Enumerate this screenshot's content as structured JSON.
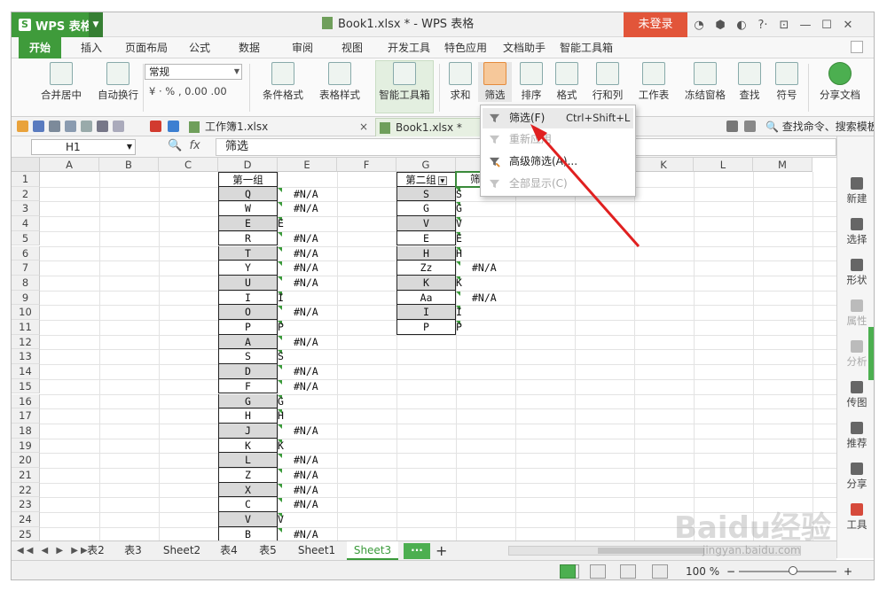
{
  "titlebar": {
    "app_name": "WPS 表格",
    "doc_title": "Book1.xlsx * - WPS 表格",
    "login": "未登录",
    "icons": [
      "skin-icon",
      "settings-icon",
      "help-icon",
      "minimize-icon",
      "maximize-icon",
      "close-icon"
    ]
  },
  "menu": {
    "tabs": [
      "开始",
      "插入",
      "页面布局",
      "公式",
      "数据",
      "审阅",
      "视图",
      "开发工具",
      "特色应用",
      "文档助手",
      "智能工具箱"
    ]
  },
  "ribbon": {
    "merge": "合并居中",
    "wrap": "自动换行",
    "format_select": "常规",
    "num_tools": "¥ · % ‚ 0.00 .00",
    "cond_format": "条件格式",
    "table_style": "表格样式",
    "smart_toolbox": "智能工具箱",
    "sum": "求和",
    "filter": "筛选",
    "sort": "排序",
    "format": "格式",
    "rowcol": "行和列",
    "worksheet": "工作表",
    "freeze": "冻结窗格",
    "find": "查找",
    "symbol": "符号",
    "share": "分享文档"
  },
  "doc_tabs": [
    {
      "label": "工作簿1.xlsx",
      "close": "×"
    },
    {
      "label": "Book1.xlsx *",
      "close": "×"
    }
  ],
  "search_cmd": "查找命令、搜索模板",
  "formula_bar": {
    "cell_ref": "H1",
    "fx": "fx",
    "content": "筛选"
  },
  "columns": [
    "A",
    "B",
    "C",
    "D",
    "E",
    "F",
    "G",
    "H",
    "I",
    "J",
    "K",
    "L",
    "M"
  ],
  "rows": [
    "1",
    "2",
    "3",
    "4",
    "5",
    "6",
    "7",
    "8",
    "9",
    "10",
    "11",
    "12",
    "13",
    "14",
    "15",
    "16",
    "17",
    "18",
    "19",
    "20",
    "21",
    "22",
    "23",
    "24",
    "25"
  ],
  "col_d": {
    "header": "第一组",
    "values": [
      "Q",
      "W",
      "E",
      "R",
      "T",
      "Y",
      "U",
      "I",
      "O",
      "P",
      "A",
      "S",
      "D",
      "F",
      "G",
      "H",
      "J",
      "K",
      "L",
      "Z",
      "X",
      "C",
      "V",
      "B"
    ]
  },
  "col_e": [
    "#N/A",
    "#N/A",
    "E",
    "#N/A",
    "#N/A",
    "#N/A",
    "#N/A",
    "I",
    "#N/A",
    "P",
    "#N/A",
    "S",
    "#N/A",
    "#N/A",
    "G",
    "H",
    "#N/A",
    "K",
    "#N/A",
    "#N/A",
    "#N/A",
    "#N/A",
    "V",
    "#N/A"
  ],
  "col_g": {
    "header": "第二组",
    "values": [
      "S",
      "G",
      "V",
      "E",
      "H",
      "Zz",
      "K",
      "Aa",
      "I",
      "P"
    ]
  },
  "col_h": {
    "header": "筛选",
    "values": [
      "S",
      "G",
      "V",
      "E",
      "H",
      "#N/A",
      "K",
      "#N/A",
      "I",
      "P"
    ]
  },
  "dropdown": {
    "items": [
      {
        "label": "筛选(F)",
        "shortcut": "Ctrl+Shift+L"
      },
      {
        "label": "重新应用",
        "shortcut": ""
      },
      {
        "label": "高级筛选(A)...",
        "shortcut": ""
      },
      {
        "label": "全部显示(C)",
        "shortcut": ""
      }
    ]
  },
  "sidebar": [
    "新建",
    "选择",
    "形状",
    "属性",
    "分析",
    "传图",
    "推荐",
    "分享",
    "工具"
  ],
  "sheets": [
    "表2",
    "表3",
    "Sheet2",
    "表4",
    "表5",
    "Sheet1",
    "Sheet3"
  ],
  "more_tab": "···",
  "add_tab": "+",
  "status": {
    "zoom": "100 %",
    "minus": "−",
    "plus": "+"
  },
  "watermark": {
    "text": "Baidu经验",
    "url": "jingyan.baidu.com"
  },
  "colors": {
    "accent": "#3f9b3b",
    "login": "#e2553a",
    "arrow": "#e02020",
    "filter_highlight": "#f6c89a"
  }
}
